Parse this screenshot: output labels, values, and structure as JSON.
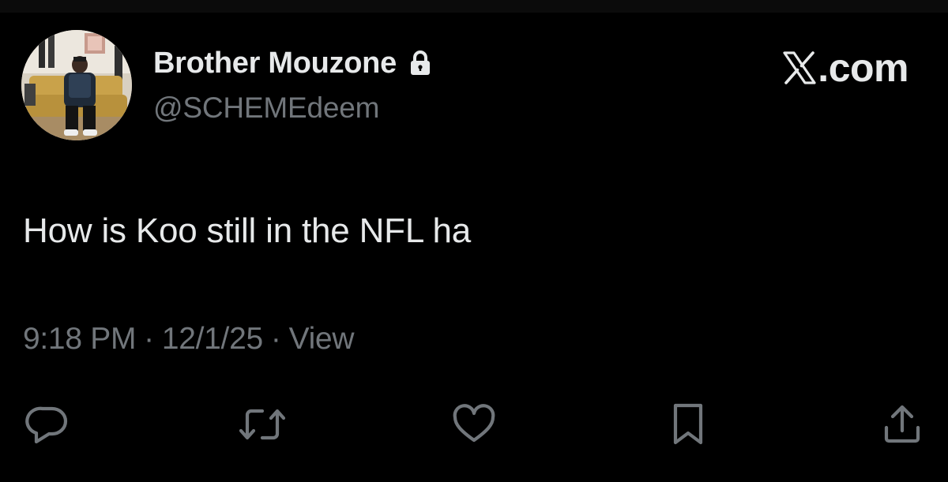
{
  "profile": {
    "display_name": "Brother Mouzone",
    "handle": "@SCHEMEdeem",
    "protected_icon": "lock-icon",
    "avatar_icon": "profile-photo"
  },
  "brand": {
    "logo_icon": "x-logo-icon",
    "text": ".com"
  },
  "tweet": {
    "text": "How is Koo still in the NFL ha"
  },
  "meta": {
    "time": "9:18 PM",
    "separator": "·",
    "date": "12/1/25",
    "views_label": "View"
  },
  "actions": [
    {
      "icon": "reply-icon"
    },
    {
      "icon": "retweet-icon"
    },
    {
      "icon": "like-icon"
    },
    {
      "icon": "bookmark-icon"
    },
    {
      "icon": "share-icon"
    }
  ],
  "colors": {
    "background": "#000000",
    "primary_text": "#e7e9ea",
    "secondary_text": "#71767b"
  }
}
